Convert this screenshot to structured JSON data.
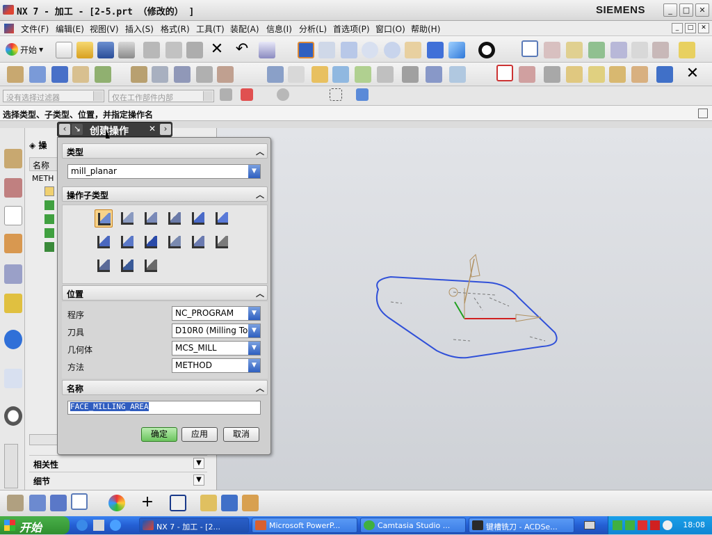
{
  "window": {
    "title": "NX 7 - 加工 - [2-5.prt （修改的） ]",
    "brand": "SIEMENS",
    "controls": [
      "_",
      "□",
      "✕"
    ]
  },
  "menu": {
    "items": [
      "文件(F)",
      "编辑(E)",
      "视图(V)",
      "插入(S)",
      "格式(R)",
      "工具(T)",
      "装配(A)",
      "信息(I)",
      "分析(L)",
      "首选项(P)",
      "窗口(O)",
      "帮助(H)"
    ]
  },
  "toolbar": {
    "start_label": "开始",
    "filter_placeholder": "没有选择过滤器",
    "scope_placeholder": "仅在工作部件内部"
  },
  "cue_line": "选择类型、子类型、位置，并指定操作名",
  "navigator": {
    "header": "操",
    "column_name": "名称",
    "method_item": "METH",
    "section_dependencies": "相关性",
    "section_details": "细节"
  },
  "dialog": {
    "title": "创建操作",
    "group_type": "类型",
    "type_value": "mill_planar",
    "group_subtype": "操作子类型",
    "subtype_count": 15,
    "selected_subtype": 0,
    "group_location": "位置",
    "location": [
      {
        "label": "程序",
        "value": "NC_PROGRAM"
      },
      {
        "label": "刀具",
        "value": "D10R0 (Milling To"
      },
      {
        "label": "几何体",
        "value": "MCS_MILL"
      },
      {
        "label": "方法",
        "value": "METHOD"
      }
    ],
    "group_name": "名称",
    "name_value": "FACE_MILLING_AREA",
    "ok_label": "确定",
    "apply_label": "应用",
    "cancel_label": "取消"
  },
  "taskbar": {
    "start_label": "开始",
    "tasks": [
      "NX 7 - 加工 - [2...",
      "Microsoft PowerP...",
      "Camtasia Studio ...",
      "键槽铣刀 - ACDSe..."
    ],
    "clock": "18:08"
  },
  "colors": {
    "part_outline": "#3050d8",
    "axis_z": "#b09060",
    "axis_x": "#d02020",
    "axis_y": "#20a020",
    "dialog_ok": "#6cc45e",
    "taskbar": "#245fd4"
  }
}
